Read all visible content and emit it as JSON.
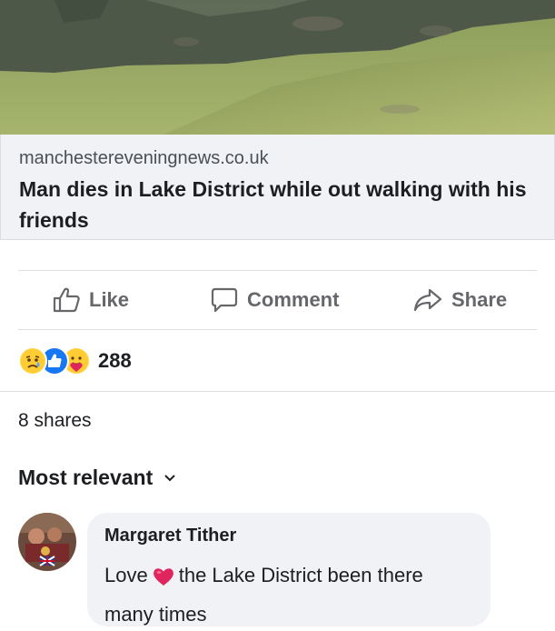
{
  "link_preview": {
    "domain": "manchestereveningnews.co.uk",
    "headline": "Man dies in Lake District while out walking with his friends"
  },
  "actions": {
    "like": "Like",
    "comment": "Comment",
    "share": "Share"
  },
  "reactions": {
    "icons": [
      "sad-icon",
      "like-icon",
      "care-icon"
    ],
    "count": "288"
  },
  "shares": "8 shares",
  "comments_filter": {
    "label": "Most relevant"
  },
  "comment": {
    "author": "Margaret Tither",
    "text_before": "Love",
    "emoji": "red-heart-icon",
    "text_after": "the Lake District been there many times"
  },
  "colors": {
    "secondary_text": "#65676b",
    "bubble_bg": "#f0f2f5",
    "like_blue": "#1877f2",
    "heart_red": "#e0245e"
  }
}
